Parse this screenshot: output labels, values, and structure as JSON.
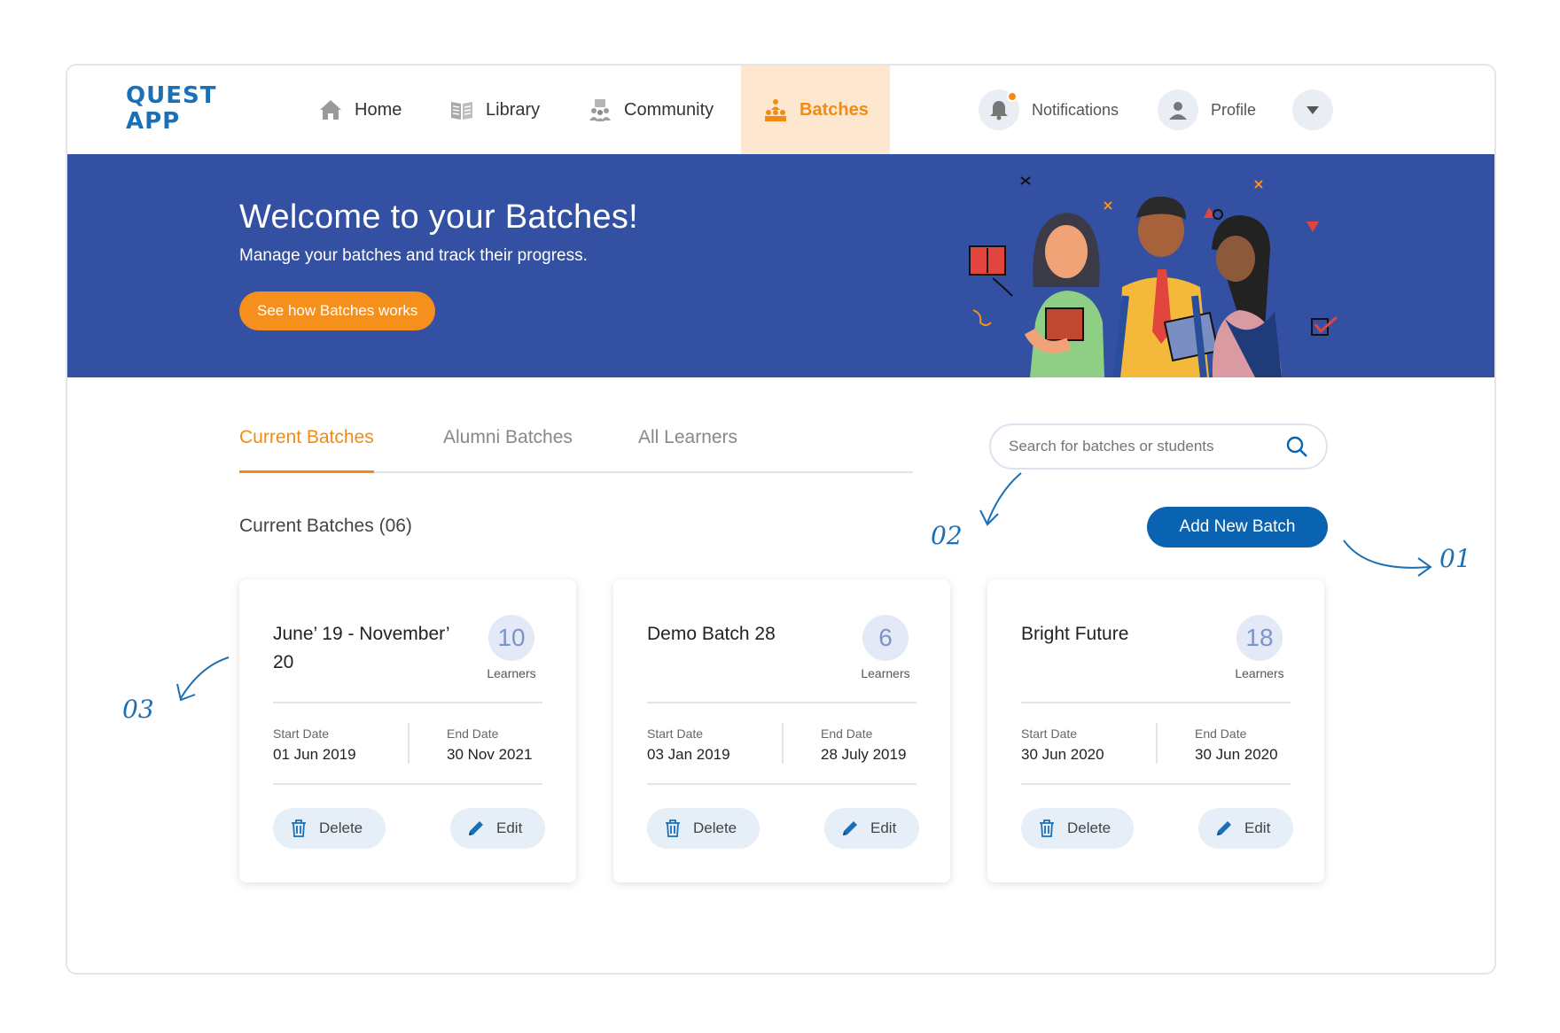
{
  "app": {
    "logo_line1": "QUEST",
    "logo_line2": "APP"
  },
  "nav": {
    "items": [
      {
        "label": "Home",
        "icon": "home-icon"
      },
      {
        "label": "Library",
        "icon": "book-icon"
      },
      {
        "label": "Community",
        "icon": "community-icon"
      },
      {
        "label": "Batches",
        "icon": "batches-icon",
        "active": true
      }
    ],
    "notifications_label": "Notifications",
    "profile_label": "Profile"
  },
  "banner": {
    "title": "Welcome to your Batches!",
    "subtitle": "Manage your batches and track their progress.",
    "cta_label": "See how Batches works"
  },
  "tabs": [
    {
      "label": "Current Batches",
      "active": true
    },
    {
      "label": "Alumni Batches"
    },
    {
      "label": "All Learners"
    }
  ],
  "search": {
    "placeholder": "Search for batches or students"
  },
  "section": {
    "title": "Current Batches (06)",
    "add_label": "Add New Batch"
  },
  "cards": [
    {
      "title": "June’ 19 - November’ 20",
      "count": "10",
      "count_label": "Learners",
      "start_label": "Start Date",
      "start": "01 Jun 2019",
      "end_label": "End Date",
      "end": "30 Nov 2021",
      "delete_label": "Delete",
      "edit_label": "Edit"
    },
    {
      "title": "Demo Batch 28",
      "count": "6",
      "count_label": "Learners",
      "start_label": "Start Date",
      "start": "03 Jan 2019",
      "end_label": "End Date",
      "end": "28 July 2019",
      "delete_label": "Delete",
      "edit_label": "Edit"
    },
    {
      "title": "Bright Future",
      "count": "18",
      "count_label": "Learners",
      "start_label": "Start Date",
      "start": "30 Jun 2020",
      "end_label": "End Date",
      "end": "30 Jun 2020",
      "delete_label": "Delete",
      "edit_label": "Edit"
    }
  ],
  "annotations": {
    "a1": "01",
    "a2": "02",
    "a3": "03"
  },
  "colors": {
    "accent": "#f38b12",
    "primary": "#0a63b0",
    "banner": "#3350a3"
  }
}
